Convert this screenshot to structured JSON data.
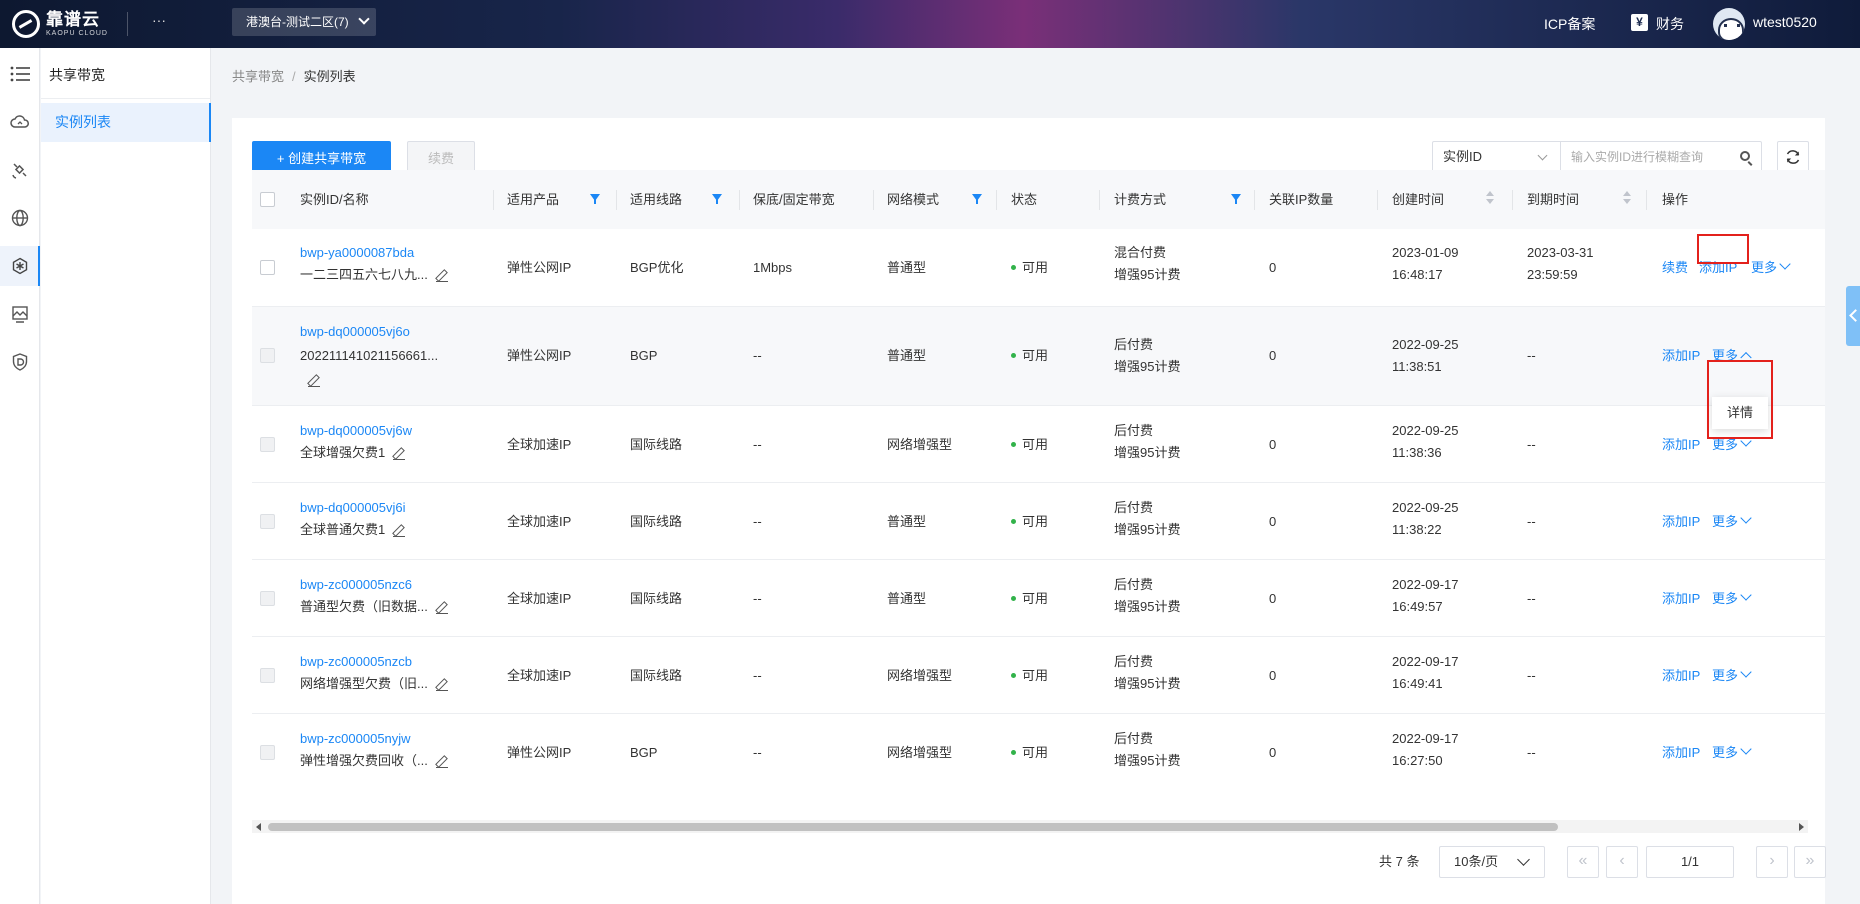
{
  "topbar": {
    "logo_cn": "靠谱云",
    "logo_en": "KAOPU CLOUD",
    "more": "···",
    "region": "港澳台-测试二区(7)",
    "icp": "ICP备案",
    "finance": "财务",
    "yen": "¥",
    "username": "wtest0520"
  },
  "sidebar": {
    "rail_icons": [
      "menu-icon",
      "cloud-icon",
      "satellite-icon",
      "globe-icon",
      "network-icon",
      "monitor-icon",
      "shield-icon"
    ],
    "title": "共享带宽",
    "items": [
      {
        "label": "实例列表"
      }
    ]
  },
  "breadcrumb": {
    "parent": "共享带宽",
    "sep": "/",
    "current": "实例列表"
  },
  "toolbar": {
    "create_label": "+ 创建共享带宽",
    "renew_label": "续费",
    "search_type": "实例ID",
    "search_placeholder": "输入实例ID进行模糊查询"
  },
  "table": {
    "headers": {
      "id_name": "实例ID/名称",
      "product": "适用产品",
      "line": "适用线路",
      "bandwidth": "保底/固定带宽",
      "mode": "网络模式",
      "status": "状态",
      "billing": "计费方式",
      "ip_count": "关联IP数量",
      "created": "创建时间",
      "expire": "到期时间",
      "ops": "操作"
    },
    "rows": [
      {
        "id": "bwp-ya0000087bda",
        "name": "一二三四五六七八九...",
        "product": "弹性公网IP",
        "line": "BGP优化",
        "bandwidth": "1Mbps",
        "mode": "普通型",
        "status": "可用",
        "billing1": "混合付费",
        "billing2": "增强95计费",
        "ip_count": "0",
        "created1": "2023-01-09",
        "created2": "16:48:17",
        "expire1": "2023-03-31",
        "expire2": "23:59:59",
        "renew": "续费",
        "add_ip": "添加IP",
        "more": "更多"
      },
      {
        "id": "bwp-dq000005vj6o",
        "name": "202211141021156661...",
        "product": "弹性公网IP",
        "line": "BGP",
        "bandwidth": "--",
        "mode": "普通型",
        "status": "可用",
        "billing1": "后付费",
        "billing2": "增强95计费",
        "ip_count": "0",
        "created1": "2022-09-25",
        "created2": "11:38:51",
        "expire1": "--",
        "expire2": "",
        "add_ip": "添加IP",
        "more": "更多"
      },
      {
        "id": "bwp-dq000005vj6w",
        "name": "全球增强欠费1",
        "product": "全球加速IP",
        "line": "国际线路",
        "bandwidth": "--",
        "mode": "网络增强型",
        "status": "可用",
        "billing1": "后付费",
        "billing2": "增强95计费",
        "ip_count": "0",
        "created1": "2022-09-25",
        "created2": "11:38:36",
        "expire1": "--",
        "expire2": "",
        "add_ip": "添加IP",
        "more": "更多"
      },
      {
        "id": "bwp-dq000005vj6i",
        "name": "全球普通欠费1",
        "product": "全球加速IP",
        "line": "国际线路",
        "bandwidth": "--",
        "mode": "普通型",
        "status": "可用",
        "billing1": "后付费",
        "billing2": "增强95计费",
        "ip_count": "0",
        "created1": "2022-09-25",
        "created2": "11:38:22",
        "expire1": "--",
        "expire2": "",
        "add_ip": "添加IP",
        "more": "更多"
      },
      {
        "id": "bwp-zc000005nzc6",
        "name": "普通型欠费（旧数据...",
        "product": "全球加速IP",
        "line": "国际线路",
        "bandwidth": "--",
        "mode": "普通型",
        "status": "可用",
        "billing1": "后付费",
        "billing2": "增强95计费",
        "ip_count": "0",
        "created1": "2022-09-17",
        "created2": "16:49:57",
        "expire1": "--",
        "expire2": "",
        "add_ip": "添加IP",
        "more": "更多"
      },
      {
        "id": "bwp-zc000005nzcb",
        "name": "网络增强型欠费（旧...",
        "product": "全球加速IP",
        "line": "国际线路",
        "bandwidth": "--",
        "mode": "网络增强型",
        "status": "可用",
        "billing1": "后付费",
        "billing2": "增强95计费",
        "ip_count": "0",
        "created1": "2022-09-17",
        "created2": "16:49:41",
        "expire1": "--",
        "expire2": "",
        "add_ip": "添加IP",
        "more": "更多"
      },
      {
        "id": "bwp-zc000005nyjw",
        "name": "弹性增强欠费回收（...",
        "product": "弹性公网IP",
        "line": "BGP",
        "bandwidth": "--",
        "mode": "网络增强型",
        "status": "可用",
        "billing1": "后付费",
        "billing2": "增强95计费",
        "ip_count": "0",
        "created1": "2022-09-17",
        "created2": "16:27:50",
        "expire1": "--",
        "expire2": "",
        "add_ip": "添加IP",
        "more": "更多"
      }
    ]
  },
  "dropdown": {
    "detail": "详情"
  },
  "pagination": {
    "total": "共 7 条",
    "page_size": "10条/页",
    "current": "1/1",
    "first": "«",
    "prev": "‹",
    "next": "›",
    "last": "»"
  },
  "colors": {
    "accent": "#1b87f5",
    "highlight": "#e3211c",
    "status_ok": "#32b24a"
  }
}
